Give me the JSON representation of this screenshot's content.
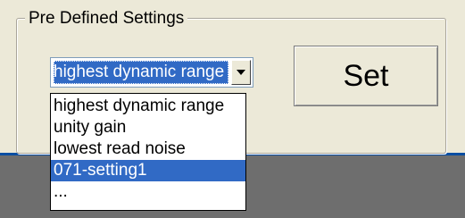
{
  "group": {
    "title": "Pre Defined Settings"
  },
  "combo": {
    "value": "highest dynamic range",
    "visible_text": "ghest dynamic range"
  },
  "set_button": {
    "label": "Set"
  },
  "dropdown": {
    "options": [
      "highest dynamic range",
      "unity gain",
      "lowest read noise",
      "071-setting1",
      "..."
    ],
    "selected_index": 3
  },
  "colors": {
    "selection": "#316ac5",
    "panel": "#ece9d8",
    "strip": "#0a4ea2",
    "lower_panel": "#6e6e6e"
  },
  "icons": {
    "combo_arrow": "chevron-down-icon"
  }
}
